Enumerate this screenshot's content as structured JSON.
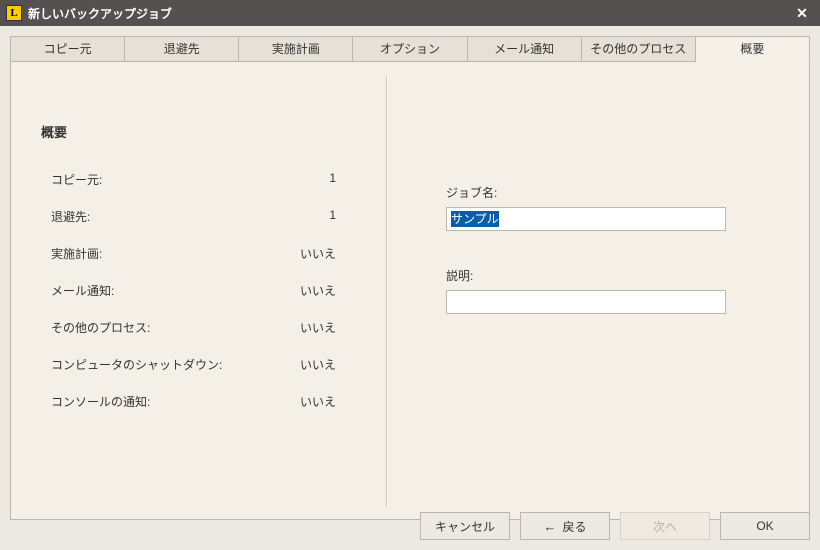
{
  "window": {
    "title": "新しいバックアップジョブ",
    "icon_label": "L"
  },
  "tabs": [
    {
      "label": "コピー元"
    },
    {
      "label": "退避先"
    },
    {
      "label": "実施計画"
    },
    {
      "label": "オプション"
    },
    {
      "label": "メール通知"
    },
    {
      "label": "その他のプロセス"
    },
    {
      "label": "概要",
      "active": true
    }
  ],
  "summary": {
    "heading": "概要",
    "rows": [
      {
        "label": "コピー元:",
        "value": "1"
      },
      {
        "label": "退避先:",
        "value": "1"
      },
      {
        "label": "実施計画:",
        "value": "いいえ"
      },
      {
        "label": "メール通知:",
        "value": "いいえ"
      },
      {
        "label": "その他のプロセス:",
        "value": "いいえ"
      },
      {
        "label": "コンピュータのシャットダウン:",
        "value": "いいえ"
      },
      {
        "label": "コンソールの通知:",
        "value": "いいえ"
      }
    ]
  },
  "fields": {
    "job_name_label": "ジョブ名:",
    "job_name_value": "サンプル",
    "description_label": "説明:",
    "description_value": ""
  },
  "footer": {
    "cancel": "キャンセル",
    "back": "戻る",
    "next": "次へ",
    "ok": "OK"
  }
}
